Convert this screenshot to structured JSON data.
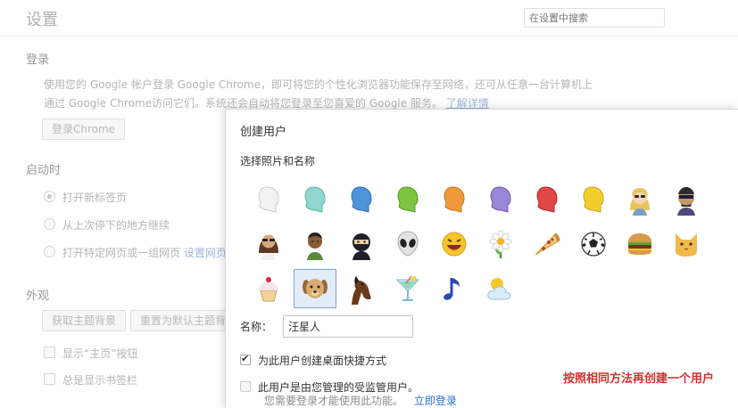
{
  "settings": {
    "title": "设置",
    "search_placeholder": "在设置中搜索",
    "signin": {
      "heading": "登录",
      "desc_line1": "使用您的 Google 帐户登录 Google Chrome，即可将您的个性化浏览器功能保存至网络，还可从任意一台计算机上",
      "desc_line2": "通过 Google Chrome访问它们。系统还会自动将您登录至您喜爱的 Google 服务。",
      "learn_more": "了解详情",
      "button": "登录Chrome"
    },
    "startup": {
      "heading": "启动时",
      "options": [
        "打开新标签页",
        "从上次停下的地方继续",
        "打开特定网页或一组网页"
      ],
      "set_pages_link": "设置网页",
      "selected_index": 0
    },
    "appearance": {
      "heading": "外观",
      "get_themes": "获取主题背景",
      "reset_theme": "重置为默认主题背景",
      "show_home": "显示“主页”按钮",
      "show_bookmarks": "总是显示书签栏"
    }
  },
  "dialog": {
    "title": "创建用户",
    "subtitle": "选择照片和名称",
    "avatars": [
      "white-head-avatar",
      "teal-head-avatar",
      "blue-head-avatar",
      "green-head-avatar",
      "orange-head-avatar",
      "purple-head-avatar",
      "red-head-avatar",
      "yellow-head-avatar",
      "blonde-woman-avatar",
      "ninja-man-avatar",
      "woman-sunglasses-avatar",
      "man-avatar",
      "ninja-avatar",
      "alien-avatar",
      "smiley-avatar",
      "flower-avatar",
      "pizza-avatar",
      "soccer-ball-avatar",
      "burger-avatar",
      "cat-avatar",
      "cupcake-avatar",
      "dog-avatar",
      "horse-avatar",
      "cocktail-avatar",
      "music-note-avatar",
      "sun-cloud-avatar"
    ],
    "selected_avatar_index": 21,
    "name_label": "名称：",
    "name_value": "汪星人",
    "shortcut_label": "为此用户创建桌面快捷方式",
    "shortcut_checked": true,
    "supervised_label": "此用户是由您管理的受监管用户。",
    "supervised_note": "您需要登录才能使用此功能。",
    "signin_link": "立即登录",
    "colors": {
      "head_white": "#f2f2f2",
      "head_teal": "#8fd6cf",
      "head_blue": "#4f93d8",
      "head_green": "#7cc441",
      "head_orange": "#f09a3c",
      "head_purple": "#9c86d8",
      "head_red": "#e04848",
      "head_yellow": "#f0cf2d",
      "selection": "#7aa3d9",
      "annotation": "#d0312d"
    }
  },
  "annotation": "按照相同方法再创建一个用户"
}
